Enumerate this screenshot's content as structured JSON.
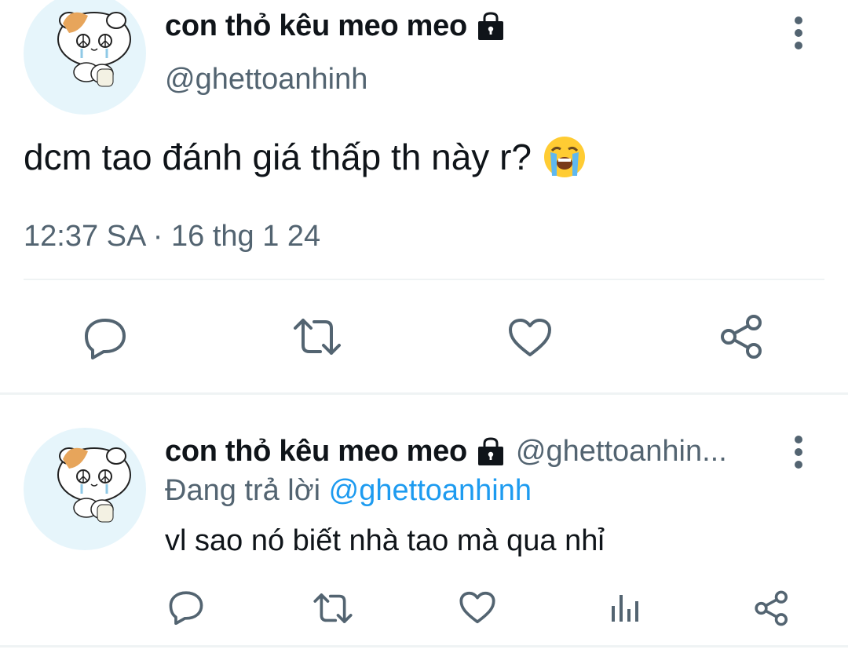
{
  "main_tweet": {
    "display_name": "con thỏ kêu meo meo",
    "handle": "@ghettoanhinh",
    "text": "dcm tao đánh giá thấp th này r?",
    "emoji": "loudly-crying-face",
    "timestamp": "12:37 SA · 16 thg 1 24",
    "protected_icon": "lock-icon",
    "actions": [
      "reply-icon",
      "retweet-icon",
      "like-icon",
      "share-icon"
    ]
  },
  "reply_tweet": {
    "display_name": "con thỏ kêu meo meo",
    "handle": "@ghettoanhin...",
    "replying_to_label": "Đang trả lời",
    "replying_to_handle": "@ghettoanhinh",
    "text": "vl sao nó biết nhà tao mà qua nhỉ",
    "protected_icon": "lock-icon",
    "actions": [
      "reply-icon",
      "retweet-icon",
      "like-icon",
      "analytics-icon",
      "share-icon"
    ]
  },
  "colors": {
    "text_primary": "#0f1419",
    "text_secondary": "#536471",
    "accent": "#1d9bf0",
    "divider": "#eff3f4",
    "avatar_bg": "#e6f5fb"
  }
}
